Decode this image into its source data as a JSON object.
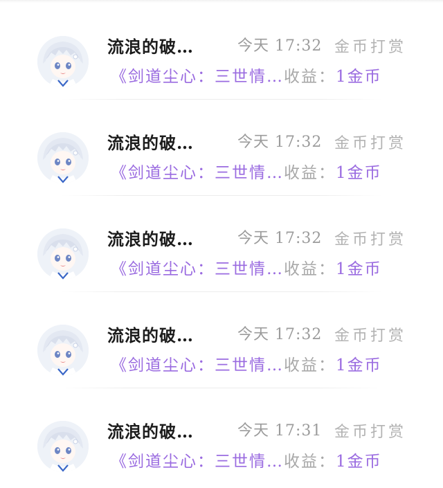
{
  "messages": [
    {
      "avatar_icon": "anime-avatar-icon",
      "sender": "流浪的破…",
      "time": "今天 17:32",
      "tip_label": "金币打赏",
      "book": "《剑道尘心：三世情…",
      "earnings_label": "收益：",
      "earnings_value": "1金币"
    },
    {
      "avatar_icon": "anime-avatar-icon",
      "sender": "流浪的破…",
      "time": "今天 17:32",
      "tip_label": "金币打赏",
      "book": "《剑道尘心：三世情…",
      "earnings_label": "收益：",
      "earnings_value": "1金币"
    },
    {
      "avatar_icon": "anime-avatar-icon",
      "sender": "流浪的破…",
      "time": "今天 17:32",
      "tip_label": "金币打赏",
      "book": "《剑道尘心：三世情…",
      "earnings_label": "收益：",
      "earnings_value": "1金币"
    },
    {
      "avatar_icon": "anime-avatar-icon",
      "sender": "流浪的破…",
      "time": "今天 17:32",
      "tip_label": "金币打赏",
      "book": "《剑道尘心：三世情…",
      "earnings_label": "收益：",
      "earnings_value": "1金币"
    },
    {
      "avatar_icon": "anime-avatar-icon",
      "sender": "流浪的破…",
      "time": "今天 17:31",
      "tip_label": "金币打赏",
      "book": "《剑道尘心：三世情…",
      "earnings_label": "收益：",
      "earnings_value": "1金币"
    }
  ],
  "colors": {
    "accent_purple": "#9a6be0",
    "sender_text": "#1c1c1c",
    "muted_text": "#9b9b9b",
    "background": "#ffffff"
  }
}
